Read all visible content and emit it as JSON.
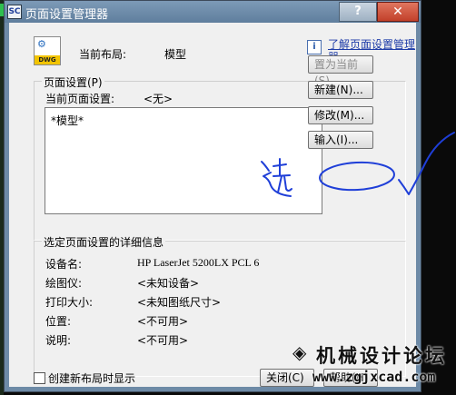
{
  "window": {
    "title": "页面设置管理器",
    "title_icon": "SC",
    "help_glyph": "?",
    "close_glyph": "✕"
  },
  "current_layout": {
    "icon_tag": "DWG",
    "label": "当前布局:",
    "value": "模型",
    "help_link": "了解页面设置管理器"
  },
  "page_setup": {
    "group_title": "页面设置(P)",
    "current_label": "当前页面设置:",
    "current_value": "<无>",
    "list_items": [
      "*模型*"
    ],
    "buttons": {
      "set_current": "置为当前(S)",
      "new": "新建(N)...",
      "modify": "修改(M)...",
      "import": "输入(I)..."
    }
  },
  "details": {
    "group_title": "选定页面设置的详细信息",
    "rows": [
      {
        "label": "设备名:",
        "value": "HP LaserJet 5200LX PCL 6"
      },
      {
        "label": "绘图仪:",
        "value": "<未知设备>"
      },
      {
        "label": "打印大小:",
        "value": "<未知图纸尺寸>"
      },
      {
        "label": "位置:",
        "value": "<不可用>"
      },
      {
        "label": "说明:",
        "value": "<不可用>"
      }
    ]
  },
  "footer": {
    "show_on_create_label": "创建新布局时显示",
    "show_on_create_checked": false,
    "close_button": "关闭(C)",
    "help_button": "帮助(H)"
  },
  "annotation": {
    "handwritten_text": "选",
    "ink_color": "#1f3fd8"
  },
  "watermark": {
    "title": "机械设计论坛",
    "url": "www.zgjxcad.com"
  },
  "colors": {
    "titlebar": "#6f8cab",
    "close": "#c8442c",
    "link": "#1f3da8"
  }
}
